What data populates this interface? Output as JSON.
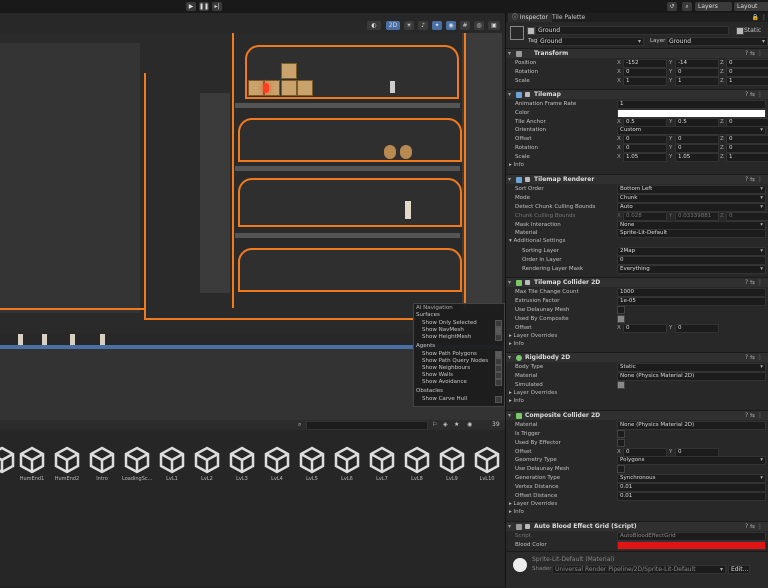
{
  "toolbar": {
    "layers_label": "Layers",
    "layout_label": "Layout"
  },
  "scene": {
    "mode_2d": "2D",
    "overlay": {
      "title": "AI Navigation",
      "surfaces_label": "Surfaces",
      "show_only_selected": "Show Only Selected",
      "show_navmesh": "Show NavMesh",
      "show_heightmesh": "Show HeightMesh",
      "agents_label": "Agents",
      "show_path_polygons": "Show Path Polygons",
      "show_path_query_nodes": "Show Path Query Nodes",
      "show_neighbours": "Show Neighbours",
      "show_walls": "Show Walls",
      "show_avoidance": "Show Avoidance",
      "obstacles_label": "Obstacles",
      "show_carve_hull": "Show Carve Hull"
    },
    "accent_color": "#f07a1e"
  },
  "project": {
    "count": "39",
    "assets": [
      "HumEnd1",
      "HumEnd2",
      "Intro",
      "LoadingSc...",
      "LvL1",
      "LvL2",
      "LvL3",
      "LvL4",
      "LvL5",
      "LvL6",
      "LvL7",
      "LvL8",
      "LvL9",
      "LvL10"
    ]
  },
  "inspector": {
    "tab_inspector": "Inspector",
    "tab_tile_palette": "Tile Palette",
    "object_name": "Ground",
    "static_label": "Static",
    "tag_label": "Tag",
    "tag_value": "Ground",
    "layer_label": "Layer",
    "layer_value": "Ground",
    "transform": {
      "title": "Transform",
      "position_label": "Position",
      "position": {
        "x": "-152",
        "y": "-14",
        "z": "0"
      },
      "rotation_label": "Rotation",
      "rotation": {
        "x": "0",
        "y": "0",
        "z": "0"
      },
      "scale_label": "Scale",
      "scale": {
        "x": "1",
        "y": "1",
        "z": "1"
      }
    },
    "tilemap": {
      "title": "Tilemap",
      "frame_rate_label": "Animation Frame Rate",
      "frame_rate": "1",
      "color_label": "Color",
      "tile_anchor_label": "Tile Anchor",
      "tile_anchor": {
        "x": "0.5",
        "y": "0.5",
        "z": "0"
      },
      "orientation_label": "Orientation",
      "orientation": "Custom",
      "offset_label": "Offset",
      "offset": {
        "x": "0",
        "y": "0",
        "z": "0"
      },
      "rotation_label": "Rotation",
      "rotation": {
        "x": "0",
        "y": "0",
        "z": "0"
      },
      "scale_label": "Scale",
      "scale": {
        "x": "1.05",
        "y": "1.05",
        "z": "1"
      },
      "info_label": "Info"
    },
    "tilemap_renderer": {
      "title": "Tilemap Renderer",
      "sort_order_label": "Sort Order",
      "sort_order": "Bottom Left",
      "mode_label": "Mode",
      "mode": "Chunk",
      "detect_label": "Detect Chunk Culling Bounds",
      "detect": "Auto",
      "chunk_bounds_label": "Chunk Culling Bounds",
      "chunk_bounds": {
        "x": "0.028",
        "y": "0.03339881",
        "z": "0"
      },
      "mask_label": "Mask Interaction",
      "mask": "None",
      "material_label": "Material",
      "material": "Sprite-Lit-Default",
      "additional_label": "Additional Settings",
      "sorting_layer_label": "Sorting Layer",
      "sorting_layer": "2Map",
      "order_label": "Order in Layer",
      "order": "0",
      "rendering_mask_label": "Rendering Layer Mask",
      "rendering_mask": "Everything"
    },
    "tilemap_collider": {
      "title": "Tilemap Collider 2D",
      "max_tile_label": "Max Tile Change Count",
      "max_tile": "1000",
      "extrusion_label": "Extrusion Factor",
      "extrusion": "1e-05",
      "delaunay_label": "Use Delaunay Mesh",
      "composite_label": "Used By Composite",
      "offset_label": "Offset",
      "offset": {
        "x": "0",
        "y": "0"
      },
      "layer_overrides_label": "Layer Overrides",
      "info_label": "Info"
    },
    "rigidbody": {
      "title": "Rigidbody 2D",
      "body_type_label": "Body Type",
      "body_type": "Static",
      "material_label": "Material",
      "material": "None (Physics Material 2D)",
      "simulated_label": "Simulated",
      "layer_overrides_label": "Layer Overrides",
      "info_label": "Info"
    },
    "composite": {
      "title": "Composite Collider 2D",
      "material_label": "Material",
      "material": "None (Physics Material 2D)",
      "trigger_label": "Is Trigger",
      "effector_label": "Used By Effector",
      "offset_label": "Offset",
      "offset": {
        "x": "0",
        "y": "0"
      },
      "geometry_label": "Geometry Type",
      "geometry": "Polygons",
      "delaunay_label": "Use Delaunay Mesh",
      "generation_label": "Generation Type",
      "generation": "Synchronous",
      "vertex_label": "Vertex Distance",
      "vertex": "0.01",
      "offset_distance_label": "Offset Distance",
      "offset_distance": "0.01",
      "layer_overrides_label": "Layer Overrides",
      "info_label": "Info"
    },
    "blood_script": {
      "title": "Auto Blood Effect Grid (Script)",
      "script_label": "Script",
      "script": "AutoBloodEffectGrid",
      "blood_color_label": "Blood Color",
      "blood_color": "#e01414"
    },
    "material_footer": {
      "name": "Sprite-Lit-Default (Material)",
      "shader_label": "Shader",
      "shader": "Universal Render Pipeline/2D/Sprite-Lit-Default",
      "edit_label": "Edit..."
    }
  }
}
